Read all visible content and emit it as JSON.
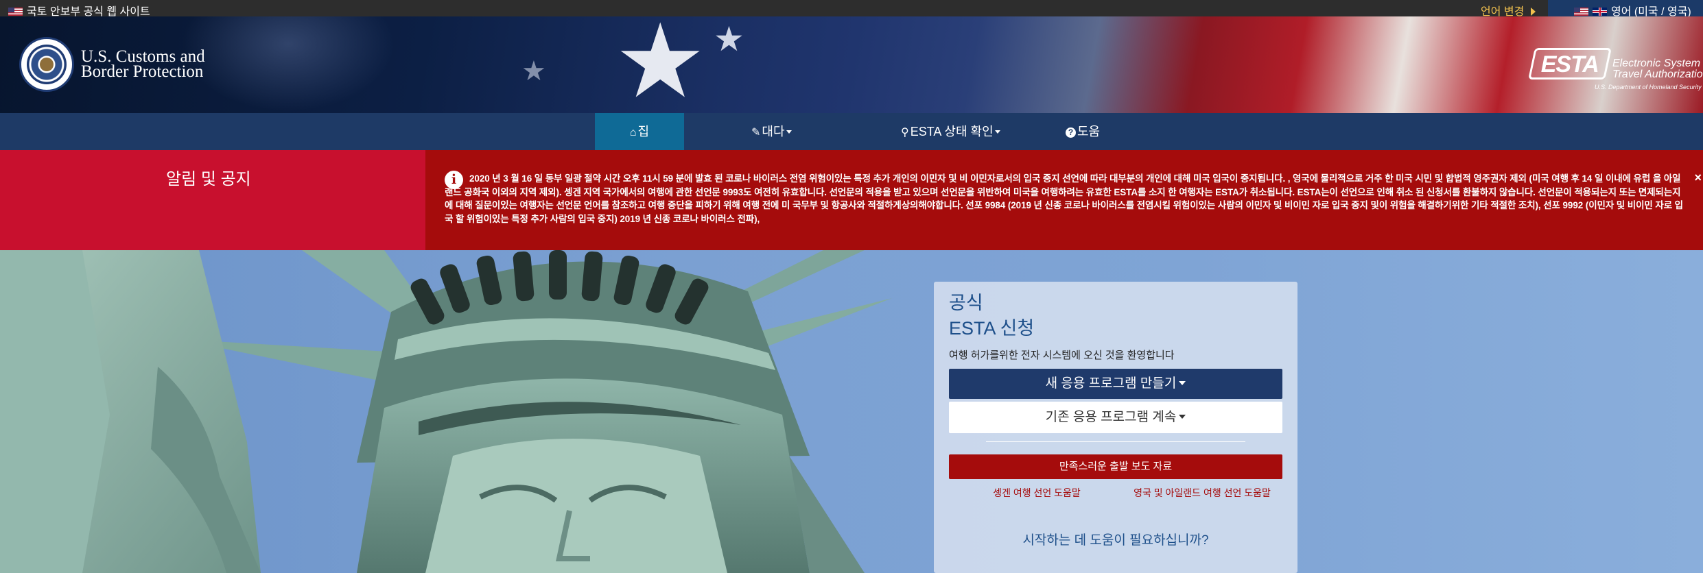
{
  "gov_bar": {
    "official_site": "국토 안보부 공식 웹 사이트",
    "language_change": "언어 변경",
    "current_language": "영어 (미국 / 영국)"
  },
  "header": {
    "agency_line1": "U.S. Customs and",
    "agency_line2": "Border Protection",
    "esta_mark": "ESTA",
    "esta_line1": "Electronic System for",
    "esta_line2": "Travel Authorization",
    "esta_line3": "U.S. Department of Homeland Security ®"
  },
  "nav": {
    "home": "집",
    "home_icon": "home-icon",
    "more": "대다",
    "more_icon": "pencil-icon",
    "status": "ESTA 상태 확인",
    "status_icon": "search-icon",
    "help": "도움",
    "help_icon": "question-circle-icon"
  },
  "alert": {
    "title": "알림 및 공지",
    "message": "2020 년 3 월 16 일 동부 일광 절약 시간 오후 11시 59 분에 발효 된 코로나 바이러스 전염 위험이있는 특정 추가 개인의 이민자 및 비 이민자로서의 입국 중지 선언에 따라 대부분의 개인에 대해 미국 입국이 중지됩니다. , 영국에 물리적으로 거주 한 미국 시민 및 합법적 영주권자 제외 (미국 여행 후 14 일 이내에 유럽 을 아일랜드 공화국 이외의 지역 제외). 셍겐 지역 국가에서의 여행에 관한 선언문 9993도 여전히 유효합니다. 선언문의 적용을 받고 있으며 선언문을 위반하여 미국을 여행하려는 유효한 ESTA를 소지 한 여행자는 ESTA가 취소됩니다. ESTA는이 선언으로 인해 취소 된 신청서를 환불하지 않습니다. 선언문이 적용되는지 또는 면제되는지에 대해 질문이있는 여행자는 선언문 언어를 참조하고 여행 중단을 피하기 위해 여행 전에 미 국무부 및 항공사와 적절하게상의해야합니다. 선포 9984 (2019 년 신종 코로나 바이러스를 전염시킬 위험이있는 사람의 이민자 및 비이민 자로 입국 중지 및이 위험을 해결하기위한 기타 적절한 조치), 선포 9992 (이민자 및 비이민 자로 입국 할 위험이있는 특정 추가 사람의 입국 중지) 2019 년 신종 코로나 바이러스 전파),",
    "info_icon": "info-icon",
    "close_symbol": "×"
  },
  "card": {
    "official": "공식",
    "esta_apply": "ESTA 신청",
    "welcome": "여행 허가를위한 전자 시스템에 오신 것을 환영합니다",
    "new_application": "새 응용 프로그램 만들기",
    "continue_application": "기존 응용 프로그램 계속",
    "news_release": "만족스러운 출발 보도 자료",
    "schengen_help": "셍겐 여행 선언 도움말",
    "uk_ireland_help": "영국 및 아일랜드 여행 선언 도움말",
    "help_start": "시작하는 데 도움이 필요하십니까?"
  },
  "colors": {
    "navy": "#1e3a66",
    "active_tab": "#0f6a96",
    "alert_red": "#c8102e",
    "alert_dark_red": "#a50c0c",
    "link_blue": "#1d4f8a",
    "gov_bar": "#2d2d2d"
  }
}
